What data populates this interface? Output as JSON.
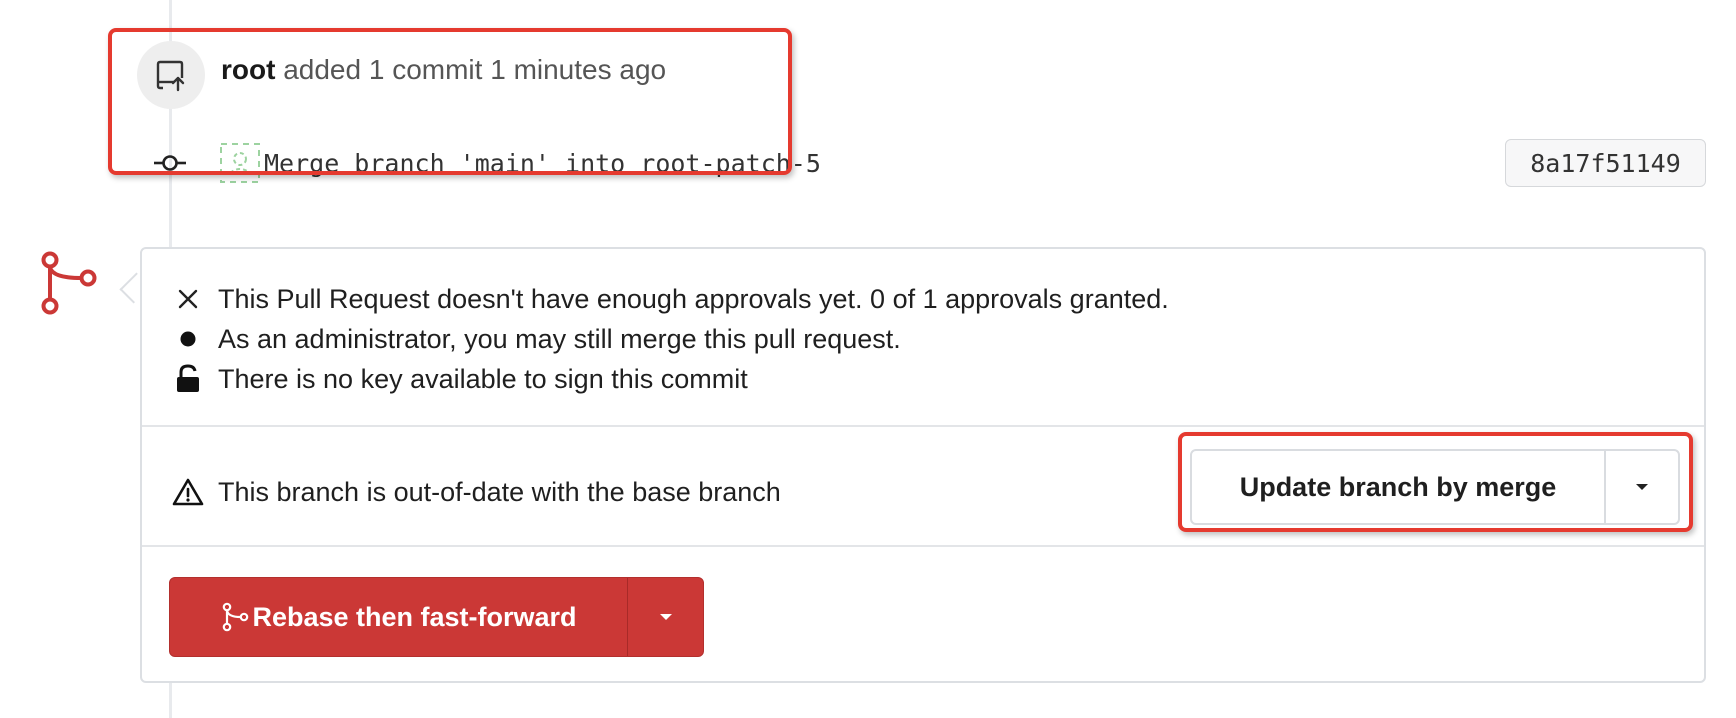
{
  "commit_event": {
    "user": "root",
    "action_text": "added 1 commit 1 minutes ago",
    "commit_message": "Merge branch 'main' into root-patch-5",
    "commit_sha": "8a17f51149"
  },
  "merge_box": {
    "statuses": [
      {
        "icon": "close-icon",
        "text": "This Pull Request doesn't have enough approvals yet. 0 of 1 approvals granted."
      },
      {
        "icon": "dot-icon",
        "text": "As an administrator, you may still merge this pull request."
      },
      {
        "icon": "unlock-icon",
        "text": "There is no key available to sign this commit"
      }
    ],
    "outdated_text": "This branch is out-of-date with the base branch",
    "update_button_label": "Update branch by merge",
    "merge_button_label": "Rebase then fast-forward"
  },
  "colors": {
    "accent_red": "#cb3836",
    "annotation_red": "#e53a2f"
  }
}
